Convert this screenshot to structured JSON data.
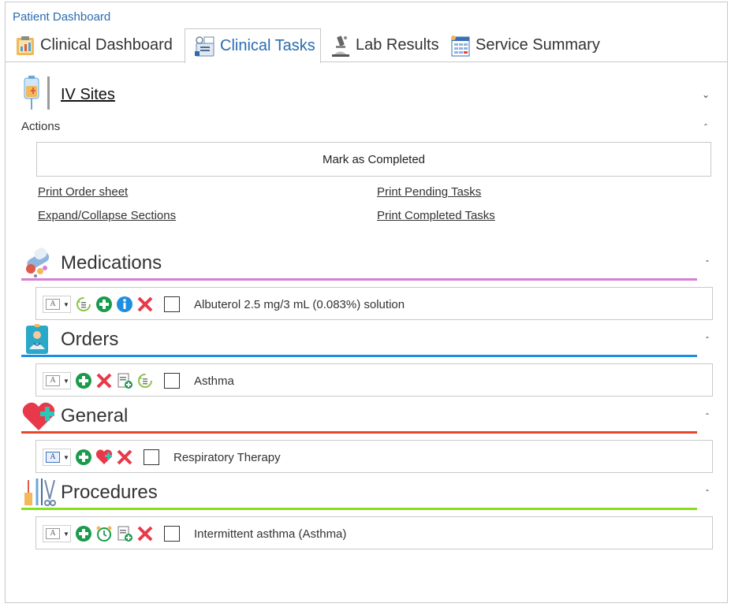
{
  "app": {
    "title": "Patient Dashboard"
  },
  "tabs": [
    {
      "label": "Clinical Dashboard",
      "icon": "clipboard-chart-icon",
      "active": false
    },
    {
      "label": "Clinical Tasks",
      "icon": "tasks-icon",
      "active": true
    },
    {
      "label": "Lab Results",
      "icon": "microscope-icon",
      "active": false
    },
    {
      "label": "Service Summary",
      "icon": "spreadsheet-icon",
      "active": false
    }
  ],
  "iv_sites": {
    "title": "IV Sites",
    "icon": "iv-bag-icon"
  },
  "actions": {
    "label": "Actions",
    "mark_completed": "Mark as Completed",
    "links": {
      "print_order_sheet": "Print Order sheet",
      "expand_collapse": "Expand/Collapse Sections",
      "print_pending": "Print Pending Tasks",
      "print_completed": "Print Completed Tasks"
    }
  },
  "sections": {
    "medications": {
      "title": "Medications",
      "color": "#d77fd6",
      "icon": "pills-icon",
      "row": {
        "label": "Albuterol 2.5 mg/3 mL (0.083%) solution"
      }
    },
    "orders": {
      "title": "Orders",
      "color": "#1e8fe0",
      "icon": "doctor-board-icon",
      "row": {
        "label": "Asthma"
      }
    },
    "general": {
      "title": "General",
      "color": "#e8462a",
      "icon": "heart-plus-icon",
      "row": {
        "label": "Respiratory Therapy"
      }
    },
    "procedures": {
      "title": "Procedures",
      "color": "#86e01e",
      "icon": "surgical-tools-icon",
      "row": {
        "label": "Intermittent asthma (Asthma)"
      }
    }
  },
  "colors": {
    "accent": "#2a6cb0",
    "add_green": "#1a9b4c",
    "delete_red": "#e8394a",
    "info_blue": "#1e8fe0"
  }
}
